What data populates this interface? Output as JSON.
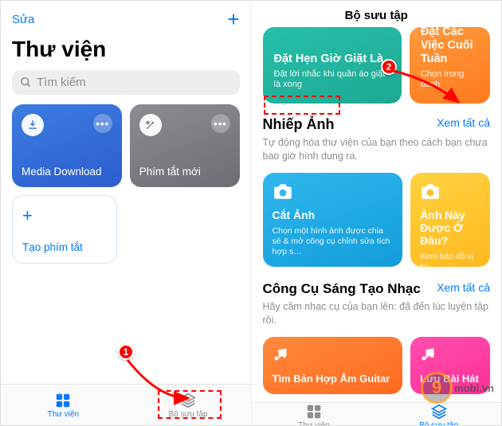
{
  "left": {
    "edit": "Sửa",
    "title": "Thư viện",
    "search_placeholder": "Tìm kiếm",
    "cards": {
      "download": "Media Download",
      "new_shortcut": "Phím tắt mới"
    },
    "create_label": "Tạo phím tắt"
  },
  "right": {
    "header": "Bộ sưu tập",
    "heroes": {
      "laundry_title": "Đặt Hẹn Giờ Giặt Là",
      "laundry_sub": "Đặt lời nhắc khi quần áo giặt là xong",
      "weekend_title": "Đặt Các Việc Cuối Tuần",
      "weekend_sub": "Chọn trong danh"
    },
    "photo_section": {
      "title": "Nhiếp Ảnh",
      "see_all": "Xem tất cả",
      "desc": "Tự động hóa thư viện của bạn theo cách bạn chưa bao giờ hình dung ra.",
      "crop_title": "Cắt Ảnh",
      "crop_sub": "Chọn một hình ảnh được chia sẻ & mở công cụ chỉnh sửa tích hợp s…",
      "where_title": "Ảnh Này Được Ở Đâu?",
      "where_sub": "Xem bản đồ vị trí"
    },
    "music_section": {
      "title": "Công Cụ Sáng Tạo Nhạc",
      "see_all": "Xem tất cả",
      "desc": "Hãy cầm nhạc cụ của bạn lên: đã đến lúc luyện tập rồi.",
      "chord_title": "Tìm Bản Hợp Âm Guitar",
      "save_title": "Lưu Bài Hát"
    }
  },
  "tabs": {
    "library": "Thư viện",
    "gallery": "Bộ sưu tập"
  },
  "badges": {
    "one": "1",
    "two": "2"
  },
  "watermark": {
    "nine": "9",
    "suffix": ".vn",
    "brand": "mobi"
  }
}
